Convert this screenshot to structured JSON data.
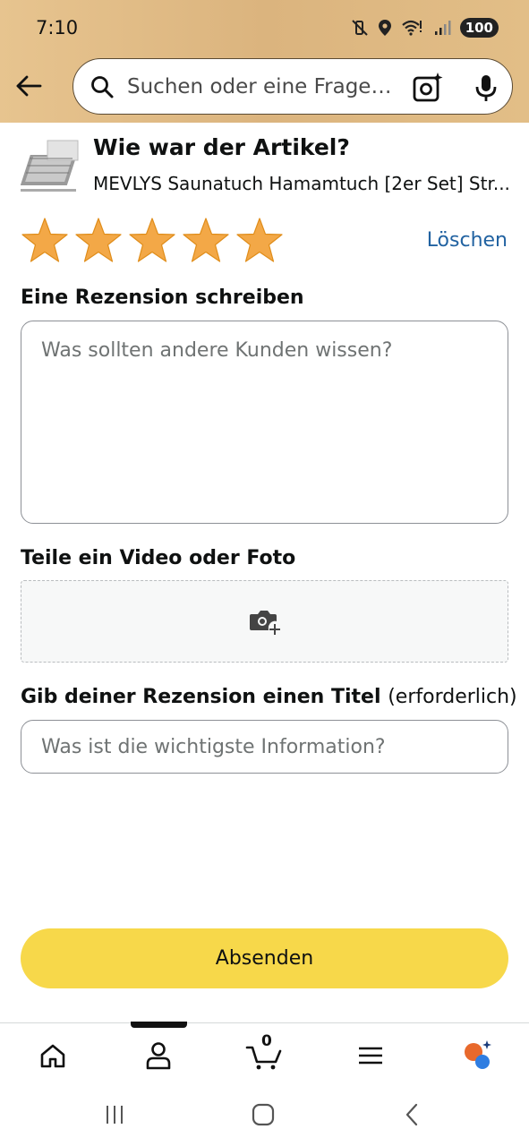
{
  "status_bar": {
    "time": "7:10",
    "battery": "100",
    "icons": [
      "mute-vibrate-icon",
      "location-icon",
      "wifi-icon",
      "signal-icon",
      "battery-icon"
    ]
  },
  "search": {
    "placeholder": "Suchen oder eine Frage…",
    "icons": [
      "search-icon",
      "camera-lens-icon",
      "microphone-icon"
    ]
  },
  "product": {
    "heading": "Wie war der Artikel?",
    "name": "MEVLYS Saunatuch Hamamtuch [2er Set] Str..."
  },
  "rating": {
    "stars": 5,
    "max": 5,
    "star_color": "#f3a847",
    "clear_label": "Löschen"
  },
  "review": {
    "label": "Eine Rezension schreiben",
    "placeholder": "Was sollten andere Kunden wissen?"
  },
  "media": {
    "label": "Teile ein Video oder Foto",
    "icon": "add-photo-icon"
  },
  "title_field": {
    "label": "Gib deiner Rezension einen Titel",
    "required_note": "(erforderlich)",
    "placeholder": "Was ist die wichtigste Information?"
  },
  "submit": {
    "label": "Absenden",
    "color": "#f7d84a"
  },
  "bottom_nav": {
    "items": [
      "home-icon",
      "account-icon",
      "cart-icon",
      "menu-icon",
      "assistant-icon"
    ],
    "cart_count": "0",
    "active": "account-icon"
  },
  "colors": {
    "header_bg": "#dfb984",
    "link": "#2162a1"
  }
}
